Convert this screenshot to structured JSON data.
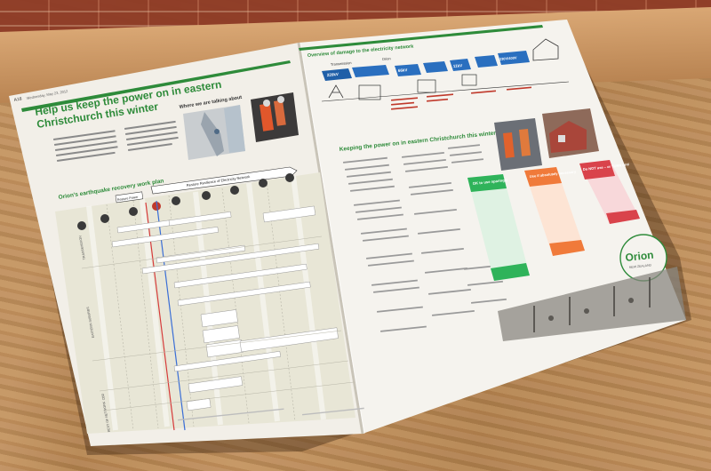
{
  "left_page": {
    "folio": "A18",
    "date_line": "Wednesday, May 23, 2012",
    "headline_line1": "Help us keep the power on in eastern",
    "headline_line2": "Christchurch this winter",
    "map_caption": "Where we are talking about",
    "plan_title": "Orion's earthquake recovery work plan",
    "resilience_label": "Restore Resilience of Electricity Network",
    "restore_power_label": "Restore Power",
    "timeline_milestones": [
      "2011",
      "2011",
      "2011",
      "2011",
      "2012",
      "2012",
      "2012",
      "2013",
      "2013",
      "2014"
    ],
    "sidebar_labels": [
      "TRANSMISSION",
      "EASTERN SUBURBS",
      "CBD",
      "REST OF NETWORK"
    ]
  },
  "right_page": {
    "section_title": "Overview of damage to the electricity network",
    "network_labels": [
      "Transmission",
      "Orion",
      "220kV",
      "Transpower substation",
      "66kV",
      "Zone substation",
      "11kV",
      "Local substation",
      "230V/400V",
      "Lines"
    ],
    "headline": "Keeping the power on in eastern Christchurch this winter",
    "box_green_title": "OK to use sparingly",
    "box_orange_title": "Use if absolutely necessary",
    "box_red_title": "Do NOT use – or TURN OFF",
    "logo_text": "Orion",
    "logo_sub": "NEW ZEALAND"
  },
  "colors": {
    "brand_green": "#2e8b3a",
    "accent_blue": "#1f5fa8",
    "box_green": "#2fb35a",
    "box_orange": "#f07a3a",
    "box_red": "#d9434b"
  }
}
